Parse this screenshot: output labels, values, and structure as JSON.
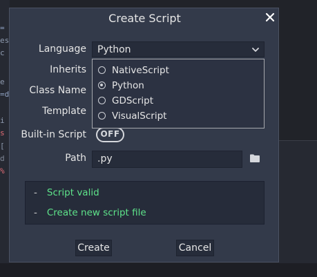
{
  "dialog": {
    "title": "Create Script",
    "close_icon": "close-icon"
  },
  "form": {
    "language_label": "Language",
    "language_value": "Python",
    "inherits_label": "Inherits",
    "class_name_label": "Class Name",
    "template_label": "Template",
    "builtin_label": "Built-in Script",
    "builtin_toggle": "OFF",
    "path_label": "Path",
    "path_value": ".py"
  },
  "language_options": [
    {
      "label": "NativeScript",
      "selected": false
    },
    {
      "label": "Python",
      "selected": true
    },
    {
      "label": "GDScript",
      "selected": false
    },
    {
      "label": "VisualScript",
      "selected": false
    }
  ],
  "status": {
    "line1_dash": "-",
    "line1": "Script valid",
    "line2_dash": "-",
    "line2": "Create new script file",
    "color": "#5ee38a"
  },
  "buttons": {
    "create": "Create",
    "cancel": "Cancel"
  },
  "colors": {
    "dialog_bg": "#333a4a",
    "field_bg": "#262c3a",
    "accent_green": "#5ee38a"
  }
}
